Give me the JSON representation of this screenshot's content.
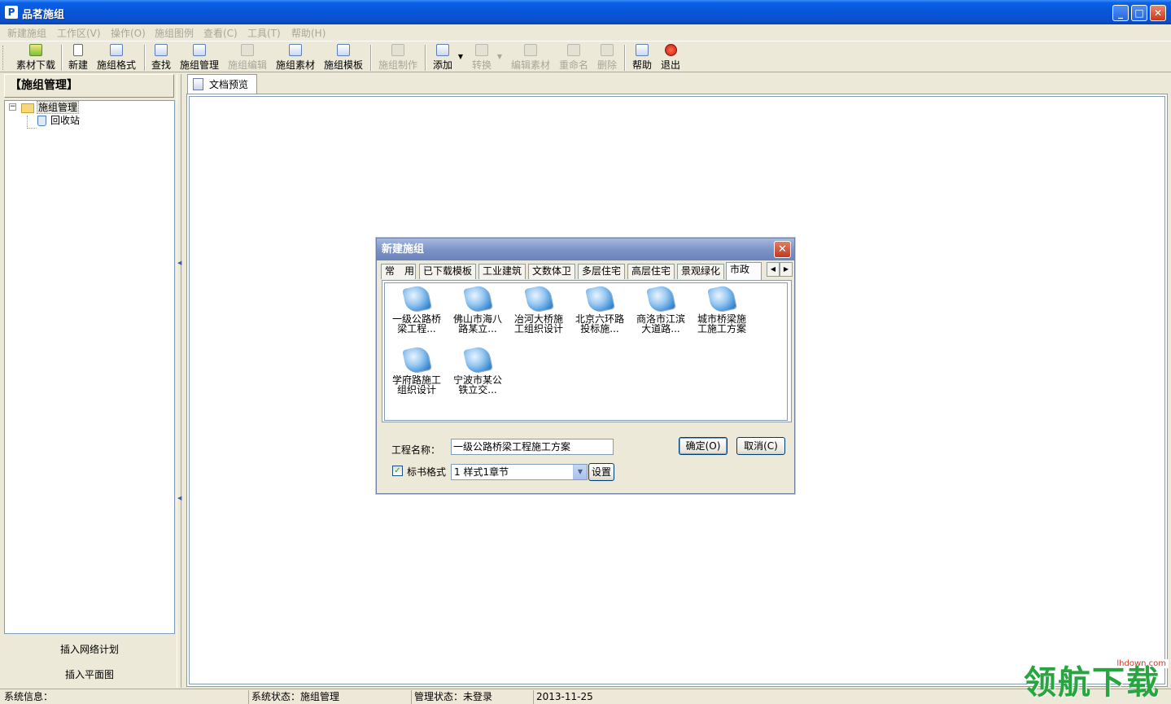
{
  "window": {
    "title": "品茗施组",
    "controls": {
      "minimize": "_",
      "maximize": "□",
      "close": "✕"
    }
  },
  "menu": [
    "新建施组",
    "工作区(V)",
    "操作(O)",
    "施组图例",
    "查看(C)",
    "工具(T)",
    "帮助(H)"
  ],
  "toolbar": {
    "material_download": "素材下载",
    "new": "新建",
    "format": "施组格式",
    "find": "查找",
    "manage": "施组管理",
    "edit": "施组编辑",
    "material": "施组素材",
    "template": "施组模板",
    "make": "施组制作",
    "add": "添加",
    "convert": "转换",
    "edit_material": "编辑素材",
    "rename": "重命名",
    "delete": "删除",
    "help": "帮助",
    "exit": "退出"
  },
  "left_panel": {
    "header": "【施组管理】",
    "tree": {
      "root": "施组管理",
      "child": "回收站"
    },
    "bottom_buttons": [
      "插入网络计划",
      "插入平面图"
    ]
  },
  "doc_tab": "文档预览",
  "status": {
    "sys_info": "系统信息：",
    "sys_state": "系统状态：施组管理",
    "mgmt_state": "管理状态：未登录",
    "date": "2013-11-25"
  },
  "dialog": {
    "title": "新建施组",
    "tabs": [
      "常　用",
      "已下载模板",
      "工业建筑",
      "文数体卫",
      "多层住宅",
      "高层住宅",
      "景观绿化",
      "市政"
    ],
    "active_tab": "市政",
    "files": [
      "一级公路桥梁工程...",
      "佛山市海八路某立...",
      "冶河大桥施工组织设计",
      "北京六环路投标施...",
      "商洛市江滨大道路...",
      "城市桥梁施工施工方案",
      "学府路施工组织设计",
      "宁波市某公铁立交..."
    ],
    "project_name_label": "工程名称：",
    "project_name_value": "一级公路桥梁工程施工方案",
    "ok": "确定(O)",
    "cancel": "取消(C)",
    "format_label": "标书格式",
    "format_checked": true,
    "format_value": "1 样式1章节",
    "settings": "设置"
  },
  "watermark": {
    "domain": "lhdown.com",
    "text": "领航下载"
  },
  "colors": {
    "titlebar": "#0a55d8",
    "dialog_title": "#7d94c8",
    "face": "#ece9d8",
    "watermark": "#27a63f"
  }
}
